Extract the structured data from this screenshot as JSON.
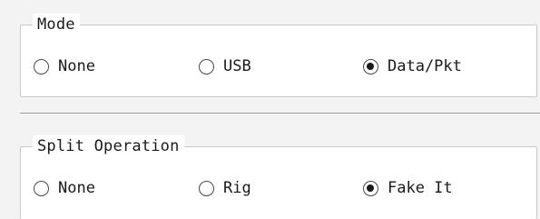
{
  "mode": {
    "title": "Mode",
    "options": [
      {
        "label": "None",
        "checked": false
      },
      {
        "label": "USB",
        "checked": false
      },
      {
        "label": "Data/Pkt",
        "checked": true
      }
    ]
  },
  "split": {
    "title": "Split Operation",
    "options": [
      {
        "label": "None",
        "checked": false
      },
      {
        "label": "Rig",
        "checked": false
      },
      {
        "label": "Fake It",
        "checked": true
      }
    ]
  }
}
